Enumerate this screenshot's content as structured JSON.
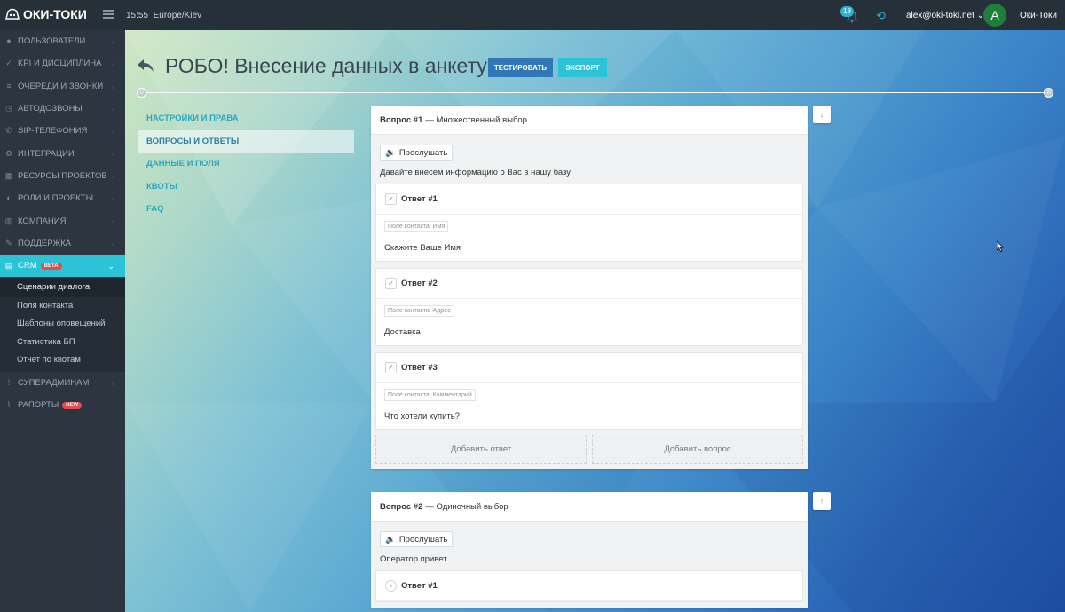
{
  "header": {
    "brand": "ОКИ-ТОКИ",
    "time": "15:55",
    "timezone": "Europe/Kiev",
    "notifications_count": "18",
    "user_email": "alex@oki-toki.net",
    "avatar_letter": "A",
    "company": "Оки-Токи"
  },
  "sidebar": {
    "items": [
      {
        "label": "ПОЛЬЗОВАТЕЛИ",
        "icon": "user-icon"
      },
      {
        "label": "KPI И ДИСЦИПЛИНА",
        "icon": "check-icon"
      },
      {
        "label": "ОЧЕРЕДИ И ЗВОНКИ",
        "icon": "list-icon"
      },
      {
        "label": "АВТОДОЗВОНЫ",
        "icon": "clock-icon"
      },
      {
        "label": "SIP-ТЕЛЕФОНИЯ",
        "icon": "phone-icon"
      },
      {
        "label": "ИНТЕГРАЦИИ",
        "icon": "gears-icon"
      },
      {
        "label": "РЕСУРСЫ ПРОЕКТОВ",
        "icon": "grid-icon"
      },
      {
        "label": "РОЛИ И ПРОЕКТЫ",
        "icon": "toggle-icon"
      },
      {
        "label": "КОМПАНИЯ",
        "icon": "bar-chart-icon"
      },
      {
        "label": "ПОДДЕРЖКА",
        "icon": "wrench-icon"
      },
      {
        "label": "CRM",
        "icon": "table-icon",
        "badge": "BETA"
      }
    ],
    "crm_sub": [
      "Сценарии диалога",
      "Поля контакта",
      "Шаблоны оповещений",
      "Статистика БП",
      "Отчет по квотам"
    ],
    "bottom": [
      {
        "label": "СУПЕРАДМИНАМ",
        "icon": "exclamation-icon"
      },
      {
        "label": "РАПОРТЫ",
        "icon": "line-chart-icon",
        "badge": "NEW"
      }
    ]
  },
  "page": {
    "title": "РОБО! Внесение данных в анкету",
    "test_button": "ТЕСТИРОВАТЬ",
    "export_button": "ЭКСПОРТ",
    "start_dot": "D",
    "end_dot": "A"
  },
  "tabs": [
    "НАСТРОЙКИ И ПРАВА",
    "ВОПРОСЫ И ОТВЕТЫ",
    "ДАННЫЕ И ПОЛЯ",
    "КВОТЫ",
    "FAQ"
  ],
  "questions": [
    {
      "number": "Вопрос #1",
      "type": "— Множественный выбор",
      "listen": "Прослушать",
      "text": "Давайте внесем информацию о Вас в нашу базу",
      "answers": [
        {
          "title": "Ответ #1",
          "field": "Поле контакта: Имя",
          "value": "Скажите Ваше Имя"
        },
        {
          "title": "Ответ #2",
          "field": "Поле контакта: Адрес",
          "value": "Доставка"
        },
        {
          "title": "Ответ #3",
          "field": "Поле контакта: Комментарий",
          "value": "Что хотели купить?"
        }
      ],
      "add_answer": "Добавить ответ",
      "add_question": "Добавить вопрос"
    },
    {
      "number": "Вопрос #2",
      "type": "— Одиночный выбор",
      "listen": "Прослушать",
      "text": "Оператор привет",
      "answers": [
        {
          "title": "Ответ #1"
        }
      ]
    }
  ],
  "colors": {
    "accent": "#2cc3d6",
    "primary": "#2f78b5",
    "sidebar": "#2c3540",
    "topbar": "#263039"
  }
}
